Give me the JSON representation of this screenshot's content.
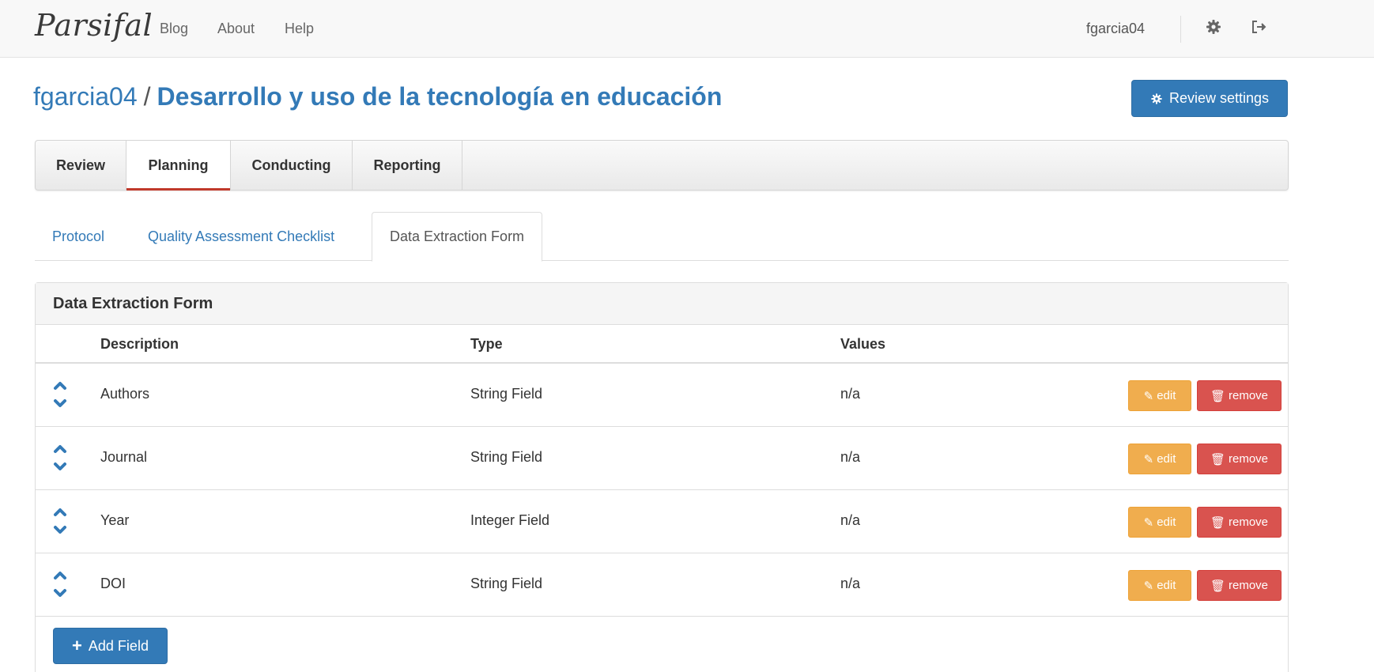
{
  "navbar": {
    "brand": "Parsifal",
    "links": [
      "Blog",
      "About",
      "Help"
    ],
    "username": "fgarcia04",
    "icons": [
      "gear-icon",
      "sign-out-icon"
    ]
  },
  "header": {
    "owner": "fgarcia04",
    "separator": "/",
    "review_title": "Desarrollo y uso de la tecnología en educación",
    "settings_button": "Review settings"
  },
  "main_tabs": [
    "Review",
    "Planning",
    "Conducting",
    "Reporting"
  ],
  "main_tab_active": "Planning",
  "sub_tabs": [
    "Protocol",
    "Quality Assessment Checklist",
    "Data Extraction Form"
  ],
  "sub_tab_active": "Data Extraction Form",
  "panel": {
    "title": "Data Extraction Form",
    "columns": [
      "Description",
      "Type",
      "Values"
    ],
    "rows": [
      {
        "description": "Authors",
        "type": "String Field",
        "values": "n/a"
      },
      {
        "description": "Journal",
        "type": "String Field",
        "values": "n/a"
      },
      {
        "description": "Year",
        "type": "Integer Field",
        "values": "n/a"
      },
      {
        "description": "DOI",
        "type": "String Field",
        "values": "n/a"
      }
    ],
    "edit_label": "edit",
    "remove_label": "remove",
    "add_button": "Add Field"
  },
  "colors": {
    "primary": "#337ab7",
    "warning": "#f0ad4e",
    "danger": "#d9534f",
    "active_tab_underline": "#c0392b"
  }
}
